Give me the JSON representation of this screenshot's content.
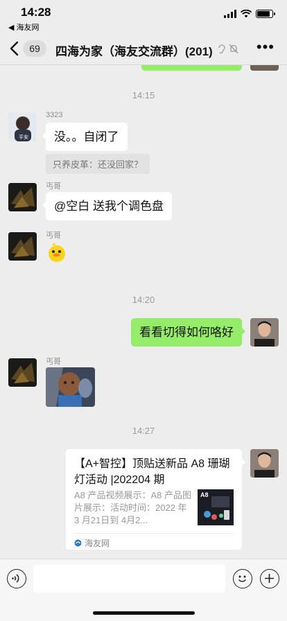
{
  "status_bar": {
    "time": "14:28",
    "back_app": "◀ 海友网",
    "battery_level": 0.85
  },
  "nav": {
    "back_count": "69",
    "title": "四海为家（海友交流群）(201)",
    "more": "•••"
  },
  "chat": {
    "time_labels": [
      "14:15",
      "14:20",
      "14:27"
    ],
    "messages": [
      {
        "sender": "3323",
        "text": "没。。自闭了",
        "quote": "只养皮革：还没回家？"
      },
      {
        "sender": "丐哥",
        "text": "@空白 送我个调色盘"
      },
      {
        "sender": "丐哥",
        "sticker": "duck-sticker"
      },
      {
        "text": "看看切得如何咯好"
      },
      {
        "sender": "丐哥",
        "image": "baby-photo"
      }
    ],
    "link_card": {
      "title": "【A+智控】顶贴送新品 A8 珊瑚灯活动 |202204 期",
      "desc": "A8 产品视频展示：A8 产品图片展示：活动时间：2022 年 3 月21日到 4月2...",
      "thumb_text": "A8",
      "source": "海友网"
    }
  },
  "input_bar": {
    "placeholder": ""
  }
}
